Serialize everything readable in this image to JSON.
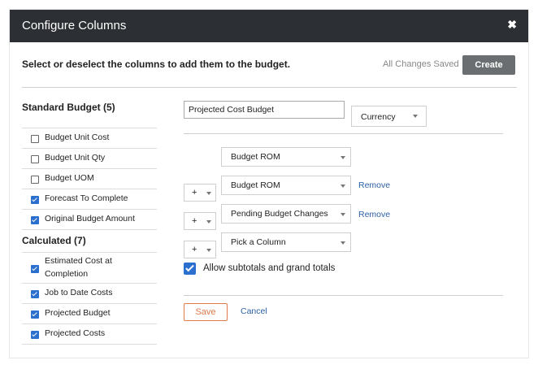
{
  "dialog": {
    "title": "Configure Columns",
    "close_glyph": "✖",
    "instruction": "Select or deselect the columns to add them to the budget.",
    "status": "All Changes Saved",
    "create_label": "Create"
  },
  "standard_budget": {
    "title": "Standard Budget (5)",
    "items": [
      {
        "label": "Budget Unit Cost",
        "checked": false
      },
      {
        "label": "Budget Unit Qty",
        "checked": false
      },
      {
        "label": "Budget UOM",
        "checked": false
      },
      {
        "label": "Forecast To Complete",
        "checked": true
      },
      {
        "label": "Original Budget Amount",
        "checked": true
      }
    ]
  },
  "calculated": {
    "title": "Calculated (7)",
    "items": [
      {
        "label": "Estimated Cost at Completion",
        "label_line1": "Estimated Cost at",
        "label_line2": "Completion",
        "checked": true
      },
      {
        "label": "Job to Date Costs",
        "checked": true
      },
      {
        "label": "Projected Budget",
        "checked": true
      },
      {
        "label": "Projected Costs",
        "checked": true
      }
    ]
  },
  "column_builder": {
    "name_value": "Projected Cost Budget",
    "format_value": "Currency",
    "rows": [
      {
        "operator": "",
        "column": "Budget ROM",
        "remove_label": ""
      },
      {
        "operator": "+",
        "column": "Budget ROM",
        "remove_label": "Remove"
      },
      {
        "operator": "+",
        "column": "Pending Budget Changes",
        "remove_label": "Remove"
      },
      {
        "operator": "+",
        "column": "Pick a Column",
        "remove_label": ""
      }
    ],
    "allow_totals_label": "Allow subtotals and grand totals",
    "allow_totals_checked": true,
    "save_label": "Save",
    "cancel_label": "Cancel"
  },
  "colors": {
    "header_bg": "#2c2f33",
    "accent_blue": "#2b6fcf",
    "save_orange": "#e07a4a",
    "link_blue": "#2b5fa6"
  }
}
